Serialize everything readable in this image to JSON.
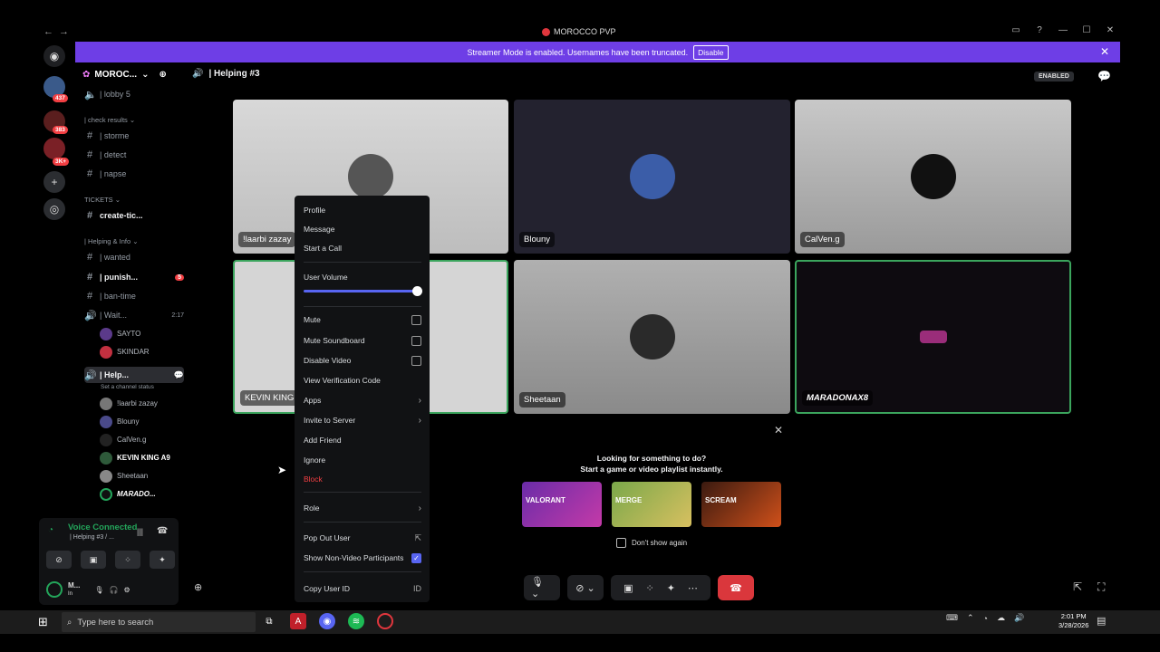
{
  "window": {
    "title": "MOROCCO PVP"
  },
  "banner": {
    "text": "Streamer Mode is enabled. Usernames have been truncated.",
    "button": "Disable"
  },
  "guilds": [
    {
      "badge": "437"
    },
    {
      "badge": "383"
    },
    {
      "badge": "3K+"
    }
  ],
  "server": {
    "name": "MOROC..."
  },
  "channels": {
    "lobby": "| lobby 5",
    "cat_check": "| check results",
    "storme": "| storme",
    "detect": "| detect",
    "napse": "| napse",
    "cat_tickets": "TICKETS",
    "create_ticket": "create-tic...",
    "cat_helping": "| Helping & Info",
    "wanted": "| wanted",
    "punish": "| punish...",
    "punish_badge": "5",
    "ban_time": "| ban-time",
    "waiting": "| Wait...",
    "waiting_time": "2:17",
    "helping": "| Help...",
    "channel_status": "Set a channel status"
  },
  "voice_users_waiting": [
    "SAYTO",
    "SKINDAR"
  ],
  "voice_users_helping": [
    "!laarbi zazay",
    "Blouny",
    "CalVen.g",
    "KEVIN KING A9",
    "Sheetaan",
    "MARADO..."
  ],
  "voice_panel": {
    "status": "Voice Connected",
    "channel": "| Helping #3 / ..."
  },
  "user": {
    "name": "M...",
    "status": "In"
  },
  "header": {
    "channel": "| Helping #3",
    "enabled_badge": "ENABLED"
  },
  "tiles": [
    {
      "name": "!laarbi zazay"
    },
    {
      "name": "Blouny"
    },
    {
      "name": "CalVen.g"
    },
    {
      "name": "KEVIN KING A"
    },
    {
      "name": "Sheetaan"
    },
    {
      "name": "MARADONAX8"
    }
  ],
  "activity": {
    "line1": "Looking for something to do?",
    "line2": "Start a game or video playlist instantly.",
    "cards": [
      "VALORANT",
      "MERGE",
      "SCREAM"
    ],
    "dont_show": "Don't show again"
  },
  "context_menu": {
    "profile": "Profile",
    "message": "Message",
    "start_call": "Start a Call",
    "user_volume": "User Volume",
    "mute": "Mute",
    "mute_soundboard": "Mute Soundboard",
    "disable_video": "Disable Video",
    "verification": "View Verification Code",
    "apps": "Apps",
    "invite": "Invite to Server",
    "add_friend": "Add Friend",
    "ignore": "Ignore",
    "block": "Block",
    "role": "Role",
    "pop_out": "Pop Out User",
    "show_non_video": "Show Non-Video Participants",
    "copy_id": "Copy User ID"
  },
  "volume_level": 1.0,
  "taskbar": {
    "search": "Type here to search",
    "time": "2:01 PM",
    "date": "3/28/2026"
  },
  "colors": {
    "accent": "#5865f2",
    "banner": "#6e3ee6",
    "danger": "#da373c",
    "speaking": "#3ba55d"
  }
}
